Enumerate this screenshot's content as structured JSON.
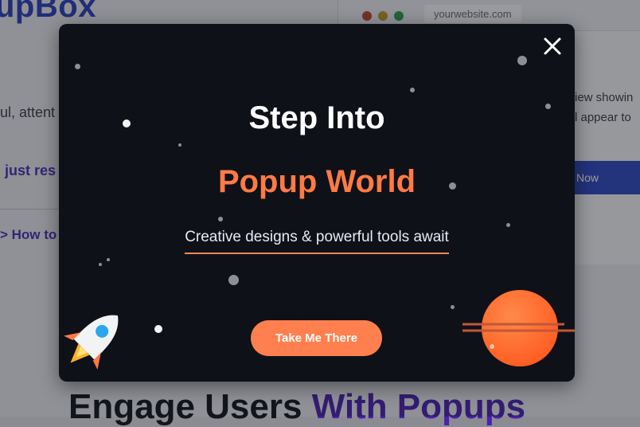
{
  "background_page": {
    "brand_fragment": "upBox",
    "text_fragment": "ul, attent",
    "link_fragment_1": "just res",
    "link_fragment_2": "> How to",
    "heading_part1": "Engage Users ",
    "heading_part2": "With Popups",
    "browser": {
      "url": "yourwebsite.com",
      "text_line_1": "iew showin",
      "text_line_2": "l appear to",
      "button_label": "Now"
    }
  },
  "popup": {
    "title": "Step Into",
    "subtitle": "Popup World",
    "tagline": "Creative designs & powerful tools await",
    "cta_label": "Take Me There",
    "close_icon": "close-icon",
    "colors": {
      "background": "#0f1118",
      "accent": "#ff7a45",
      "button": "#ff7f4e",
      "text": "#ffffff"
    }
  }
}
